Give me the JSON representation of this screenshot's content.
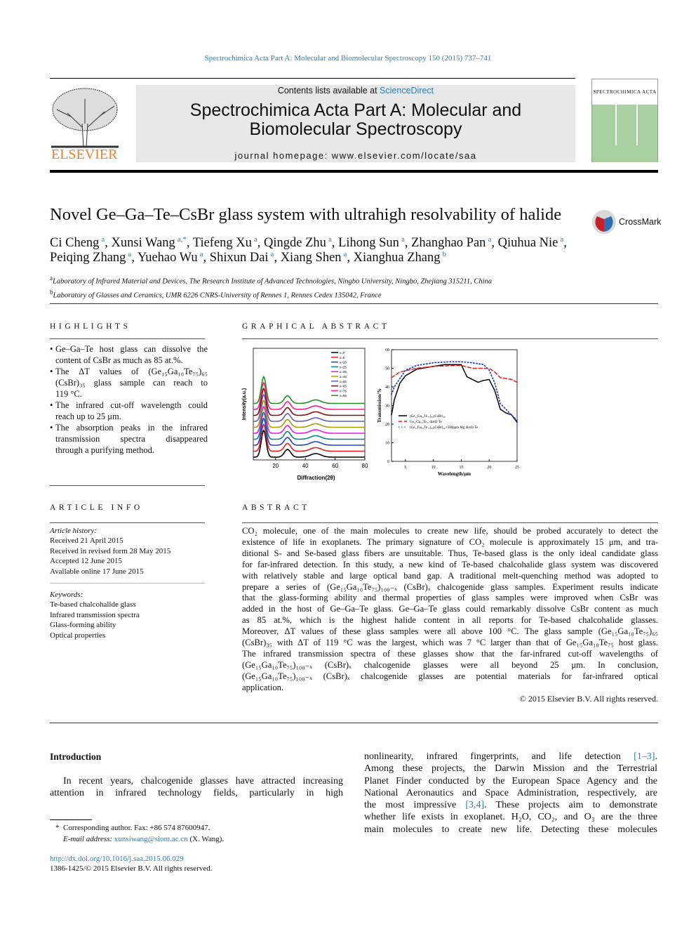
{
  "header": {
    "citation": "Spectrochimica Acta Part A: Molecular and Biomolecular Spectroscopy 150 (2015) 737–741",
    "contents_prefix": "Contents lists available at ",
    "sciencedirect": "ScienceDirect",
    "journal_line1": "Spectrochimica Acta Part A: Molecular and",
    "journal_line2": "Biomolecular Spectroscopy",
    "homepage": "journal homepage: www.elsevier.com/locate/saa",
    "publisher_logo": "ELSEVIER",
    "cover_title": "SPECTROCHIMICA ACTA",
    "brand_orange": "#f07e26",
    "link_color": "#2a7fb8"
  },
  "article": {
    "title": "Novel Ge–Ga–Te–CsBr glass system with ultrahigh resolvability of halide",
    "crossmark": "CrossMark",
    "authors_line1": [
      {
        "name": "Ci Cheng",
        "sup": "a"
      },
      {
        "name": "Xunsi Wang",
        "sup": "a,*"
      },
      {
        "name": "Tiefeng Xu",
        "sup": "a"
      },
      {
        "name": "Qingde Zhu",
        "sup": "a"
      },
      {
        "name": "Lihong Sun",
        "sup": "a"
      },
      {
        "name": "Zhanghao Pan",
        "sup": "a"
      },
      {
        "name": "Qiuhua Nie",
        "sup": "a"
      }
    ],
    "authors_line2": [
      {
        "name": "Peiqing Zhang",
        "sup": "a"
      },
      {
        "name": "Yuehao Wu",
        "sup": "a"
      },
      {
        "name": "Shixun Dai",
        "sup": "a"
      },
      {
        "name": "Xiang Shen",
        "sup": "a"
      },
      {
        "name": "Xianghua Zhang",
        "sup": "b"
      }
    ],
    "affiliations": [
      {
        "sup": "a",
        "text": "Laboratory of Infrared Material and Devices, The Research Institute of Advanced Technologies, Ningbo University, Ningbo, Zhejiang 315211, China"
      },
      {
        "sup": "b",
        "text": "Laboratory of Glasses and Ceramics, UMR 6226 CNRS-University of Rennes 1, Rennes Cedex 135042, France"
      }
    ]
  },
  "highlights": {
    "heading": "HIGHLIGHTS",
    "lines": [
      [
        "Ge–Ga–Te host glass can dissolve the",
        "content of CsBr as much as 85 at.%."
      ],
      [
        "The ΔT values of (Ge₁₅Ga₁₀Te₇₅)₆₅",
        "(CsBr)₃₅ glass sample can reach to",
        "119 °C."
      ],
      [
        "The infrared cut-off wavelength could",
        "reach up to 25 μm."
      ],
      [
        "The absorption peaks in the infrared",
        "transmission spectra disappeared",
        "through a purifying method."
      ]
    ]
  },
  "graphical_abstract": {
    "heading": "GRAPHICAL ABSTRACT"
  },
  "chart_data": [
    {
      "type": "line",
      "xlabel": "Diffraction(2θ)",
      "ylabel": "Intensity(a.u.)",
      "xlim": [
        5,
        80
      ],
      "xticks": [
        20,
        40,
        60,
        80
      ],
      "peaks_2theta": [
        12,
        28,
        47
      ],
      "series": [
        {
          "name": "x=0",
          "color": "#000000"
        },
        {
          "name": "x=5",
          "color": "#e82020"
        },
        {
          "name": "x=15",
          "color": "#2040e0"
        },
        {
          "name": "x=25",
          "color": "#108080"
        },
        {
          "name": "x=35",
          "color": "#e020e0"
        },
        {
          "name": "x=45",
          "color": "#a0a000"
        },
        {
          "name": "x=55",
          "color": "#6060c0"
        },
        {
          "name": "x=65",
          "color": "#801010"
        },
        {
          "name": "x=75",
          "color": "#ff2080"
        },
        {
          "name": "x=85",
          "color": "#209020"
        }
      ]
    },
    {
      "type": "line",
      "xlabel": "Wavelength/μm",
      "ylabel": "Transmission/%",
      "xlim": [
        2.5,
        25
      ],
      "ylim": [
        0,
        60
      ],
      "xticks": [
        5,
        10,
        15,
        20,
        25
      ],
      "yticks": [
        0,
        10,
        20,
        30,
        40,
        50,
        60
      ],
      "series": [
        {
          "name": "(Ge₁₅Ga₁₀Te₇₅)₈₀(CsBr)₂₀",
          "color": "#000000",
          "style": "solid",
          "x": [
            2.5,
            3,
            4,
            5,
            7,
            10,
            12,
            15,
            16,
            17,
            18,
            19,
            20,
            21,
            22,
            23,
            24,
            25
          ],
          "y": [
            25,
            33,
            42,
            46,
            49.5,
            51,
            52,
            52,
            45.5,
            44,
            42.5,
            43.5,
            44,
            38,
            28,
            26,
            25,
            21
          ]
        },
        {
          "name": "Ge₁₅Ga₁₀Te₇₅ distill Te",
          "color": "#e82020",
          "style": "dashed",
          "x": [
            2.5,
            4,
            7,
            10,
            14,
            15,
            17,
            19,
            20,
            21,
            22,
            23,
            24,
            25
          ],
          "y": [
            45,
            48,
            50,
            51,
            51.5,
            51.5,
            50,
            50,
            50,
            48,
            45,
            44.5,
            44,
            42.5
          ]
        },
        {
          "name": "(Ge₁₅Ga₁₀Te₇₅)₈₀(CsBr)₂₀+500ppm Mg distill Te",
          "color": "#2040e0",
          "style": "dotted",
          "x": [
            2.5,
            3,
            5,
            7,
            10,
            13,
            15,
            17,
            19,
            20,
            21,
            22,
            23,
            24,
            25
          ],
          "y": [
            36,
            40,
            49,
            51.5,
            53,
            53.5,
            53.5,
            53,
            52,
            49,
            42,
            31,
            28,
            25,
            22
          ]
        }
      ]
    }
  ],
  "article_info": {
    "heading": "ARTICLE INFO",
    "history_label": "Article history:",
    "history": [
      "Received 21 April 2015",
      "Received in revised form 28 May 2015",
      "Accepted 12 June 2015",
      "Available online 17 June 2015"
    ],
    "keywords_label": "Keywords:",
    "keywords": [
      "Te-based chalcohalide glass",
      "Infrared transmission spectra",
      "Glass-forming ability",
      "Optical properties"
    ]
  },
  "abstract": {
    "heading": "ABSTRACT",
    "lines": [
      "CO₂ molecule, one of the main molecules to create new life, should be probed accurately to detect the",
      "existence of life in exoplanets. The primary signature of CO₂ molecule is approximately 15 μm, and tra-",
      "ditional S- and Se-based glass fibers are unsuitable. Thus, Te-based glass is the only ideal candidate glass",
      "for far-infrared detection. In this study, a new kind of Te-based chalcohalide glass system was discovered",
      "with relatively stable and large optical band gap. A traditional melt-quenching method was adopted to",
      "prepare a series of (Ge₁₅Ga₁₀Te₇₅)₁₀₀₋ₓ (CsBr)ₓ chalcogenide glass samples. Experiment results indicate",
      "that the glass-forming ability and thermal properties of glass samples were improved when CsBr was",
      "added in the host of Ge–Ga–Te glass. Ge–Ga–Te glass could remarkably dissolve CsBr content as much",
      "as 85 at.%, which is the highest halide content in all reports for Te-based chalcohalide glasses.",
      "Moreover, ΔT values of these glass samples were all above 100 °C. The glass sample (Ge₁₅Ga₁₀Te₇₅)₆₅",
      "(CsBr)₃₅ with ΔT of 119 °C was the largest, which was 7 °C larger than that of Ge₁₅Ga₁₀Te₇₅ host glass.",
      "The infrared transmission spectra of these glasses show that the far-infrared cut-off wavelengths of",
      "(Ge₁₅Ga₁₀Te₇₅)₁₀₀₋ₓ (CsBr)ₓ chalcogenide glasses were all beyond 25 μm. In conclusion,",
      "(Ge₁₅Ga₁₀Te₇₅)₁₀₀₋ₓ (CsBr)ₓ chalcogenide glasses are potential materials for far-infrared optical",
      "application."
    ],
    "copyright": "© 2015 Elsevier B.V. All rights reserved."
  },
  "body": {
    "intro_heading": "Introduction",
    "left_lines": [
      "In recent years, chalcogenide glasses have attracted increasing",
      "attention in infrared technology fields, particularly in high"
    ],
    "right_lines": [
      {
        "text": "nonlinearity, infrared fingerprints, and life detection ",
        "ref": "[1–3]",
        "after": "."
      },
      {
        "text": "Among these projects, the Darwin Mission and the Terrestrial"
      },
      {
        "text": "Planet Finder conducted by the European Space Agency and the"
      },
      {
        "text": "National Aeronautics and Space Administration, respectively, are"
      },
      {
        "text": "the most impressive ",
        "ref": "[3,4]",
        "after": ". These projects aim to demonstrate"
      },
      {
        "text": "whether life exists in exoplanet. H₂O, CO₂, and O₃ are the three"
      },
      {
        "text": "main molecules to create new life. Detecting these molecules"
      }
    ]
  },
  "footnote": {
    "star": "*",
    "corresponding": "Corresponding author. Fax: +86 574 87600947.",
    "email_label": "E-mail address: ",
    "email": "xunsiwang@siom.ac.cn",
    "email_after": " (X. Wang).",
    "doi": "http://dx.doi.org/10.1016/j.saa.2015.06.029",
    "issn": "1386-1425/© 2015 Elsevier B.V. All rights reserved."
  }
}
